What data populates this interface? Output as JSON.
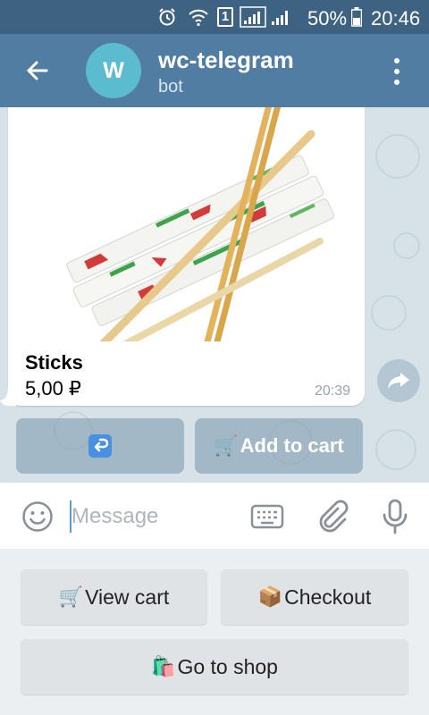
{
  "status_bar": {
    "battery_percent": "50%",
    "time": "20:46",
    "sim_number": "1"
  },
  "header": {
    "avatar_letter": "W",
    "title": "wc-telegram",
    "subtitle": "bot"
  },
  "message": {
    "product_name": "Sticks",
    "price": "5,00 ₽",
    "time": "20:39",
    "photo_subject": "chopsticks"
  },
  "inline_buttons": [
    {
      "icon": "return-icon",
      "label": ""
    },
    {
      "icon": "shopping-cart-icon",
      "emoji": "🛒",
      "label": "Add to cart"
    }
  ],
  "composer": {
    "placeholder": "Message"
  },
  "reply_keyboard": [
    {
      "emoji": "🛒",
      "label": "View cart"
    },
    {
      "emoji": "📦",
      "label": "Checkout"
    },
    {
      "emoji": "🛍️",
      "label": "Go to shop"
    }
  ],
  "colors": {
    "status_bar": "#3e6281",
    "header": "#527da3",
    "avatar": "#5bbccf",
    "chat_background": "#d6e2e8"
  }
}
